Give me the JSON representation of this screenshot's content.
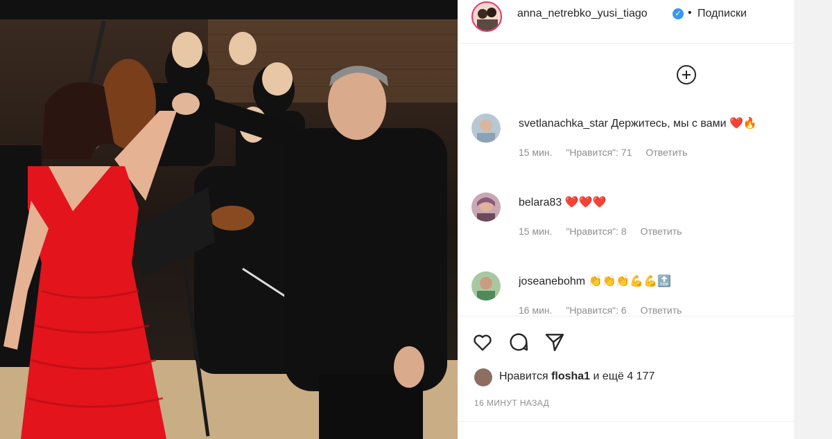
{
  "photo": {
    "alt": ""
  },
  "post": {
    "username": "anna_netrebko_yusi_tiago",
    "dot": "•",
    "follow_label": "Подписки"
  },
  "comments": [
    {
      "user": "svetlanachka_star",
      "text": "Держитесь, мы с вами ❤️🔥",
      "time": "15 мин.",
      "likes": "\"Нравится\": 71",
      "reply": "Ответить"
    },
    {
      "user": "belara83",
      "text": "❤️❤️❤️",
      "time": "15 мин.",
      "likes": "\"Нравится\": 8",
      "reply": "Ответить"
    },
    {
      "user": "joseanebohm",
      "text": "👏👏👏💪💪🔝",
      "time": "16 мин.",
      "likes": "\"Нравится\": 6",
      "reply": "Ответить"
    }
  ],
  "likes": {
    "prefix": "Нравится",
    "user": "flosha1",
    "suffix": "и ещё 4 177"
  },
  "posted": "16 МИНУТ НАЗАД",
  "colors": {
    "dress": "#e3141c",
    "verified": "#3897f0",
    "story_ring": "#e1306c"
  },
  "icons": [
    "add-circle-icon",
    "heart-icon",
    "comment-icon",
    "share-icon",
    "verified-icon"
  ]
}
